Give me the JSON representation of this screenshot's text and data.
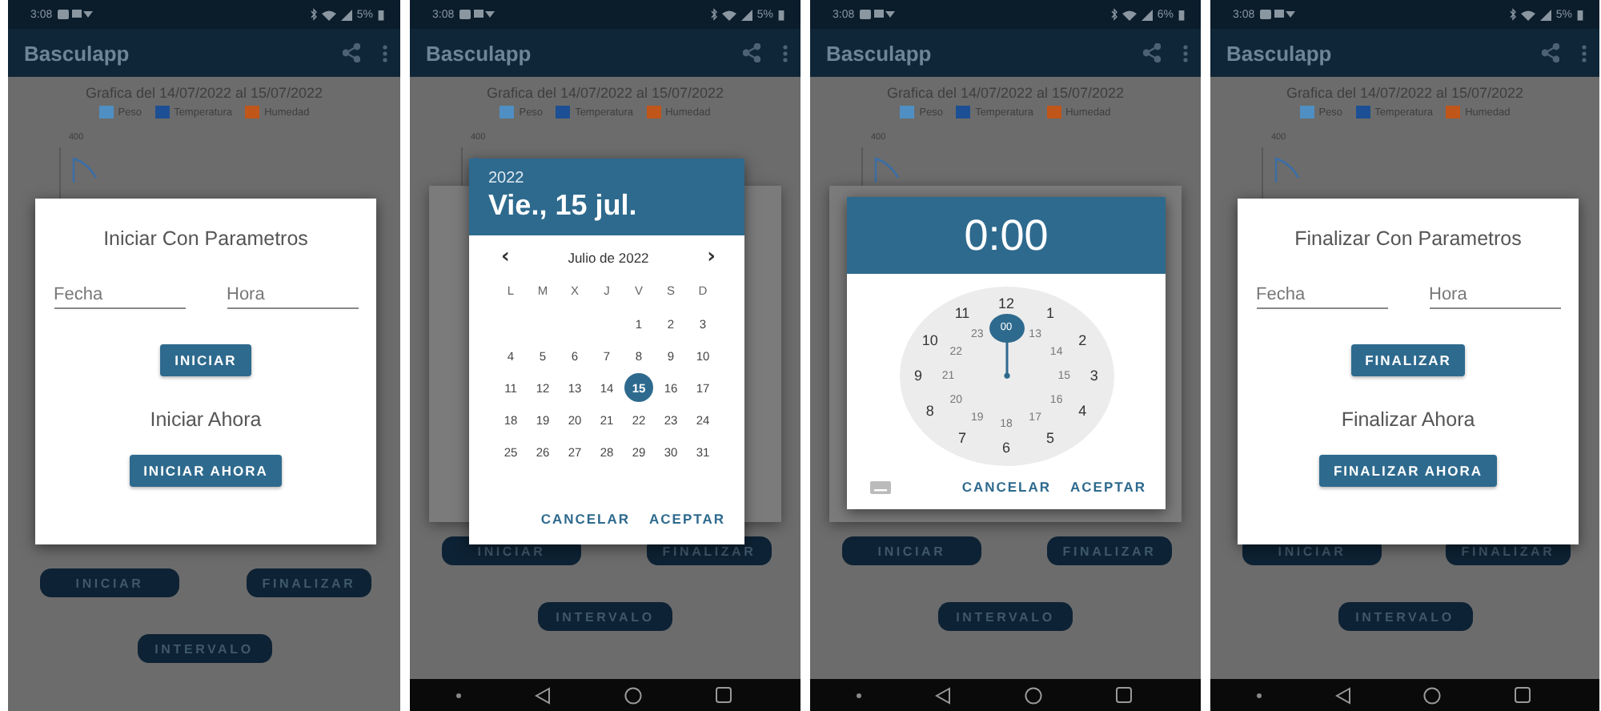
{
  "phones": [
    {
      "status_bar": {
        "time": "3:08",
        "battery": "5%"
      },
      "app_bar": {
        "title": "Basculapp"
      },
      "chart": {
        "title": "Grafica del 14/07/2022 al 15/07/2022",
        "legend": [
          {
            "label": "Peso",
            "color": "#4f8fc4"
          },
          {
            "label": "Temperatura",
            "color": "#1d4f94"
          },
          {
            "label": "Humedad",
            "color": "#c0561a"
          }
        ],
        "y_tick": "400"
      },
      "buttons": [
        "INICIAR",
        "FINALIZAR",
        "INTERVALO"
      ],
      "nav_bar": false,
      "dialog_behind": false,
      "dialog": {
        "kind": "params",
        "title": "Iniciar Con Parametros",
        "fields": [
          {
            "placeholder": "Fecha"
          },
          {
            "placeholder": "Hora"
          }
        ],
        "action": "INICIAR",
        "now_label": "Iniciar Ahora",
        "now_action": "INICIAR AHORA"
      }
    },
    {
      "status_bar": {
        "time": "3:08",
        "battery": "5%"
      },
      "app_bar": {
        "title": "Basculapp"
      },
      "chart": {
        "title": "Grafica del 14/07/2022 al 15/07/2022",
        "legend": [
          {
            "label": "Peso",
            "color": "#4f8fc4"
          },
          {
            "label": "Temperatura",
            "color": "#1d4f94"
          },
          {
            "label": "Humedad",
            "color": "#c0561a"
          }
        ],
        "y_tick": "400"
      },
      "buttons": [
        "INICIAR",
        "FINALIZAR",
        "INTERVALO"
      ],
      "nav_bar": true,
      "dialog_behind": true,
      "dialog": {
        "kind": "date",
        "year": "2022",
        "date": "Vie., 15 jul.",
        "month": "Julio de 2022",
        "prev": "‹",
        "next": "›",
        "weekdays": [
          "L",
          "M",
          "X",
          "J",
          "V",
          "S",
          "D"
        ],
        "weeks": [
          [
            {
              "label": "1",
              "selected": false
            },
            {
              "label": "2",
              "selected": false
            },
            {
              "label": "3",
              "selected": false
            }
          ],
          [
            {
              "label": "4",
              "selected": false
            },
            {
              "label": "5",
              "selected": false
            },
            {
              "label": "6",
              "selected": false
            },
            {
              "label": "7",
              "selected": false
            },
            {
              "label": "8",
              "selected": false
            },
            {
              "label": "9",
              "selected": false
            },
            {
              "label": "10",
              "selected": false
            }
          ],
          [
            {
              "label": "11",
              "selected": false
            },
            {
              "label": "12",
              "selected": false
            },
            {
              "label": "13",
              "selected": false
            },
            {
              "label": "14",
              "selected": false
            },
            {
              "label": "15",
              "selected": true
            },
            {
              "label": "16",
              "selected": false
            },
            {
              "label": "17",
              "selected": false
            }
          ],
          [
            {
              "label": "18",
              "selected": false
            },
            {
              "label": "19",
              "selected": false
            },
            {
              "label": "20",
              "selected": false
            },
            {
              "label": "21",
              "selected": false
            },
            {
              "label": "22",
              "selected": false
            },
            {
              "label": "23",
              "selected": false
            },
            {
              "label": "24",
              "selected": false
            }
          ],
          [
            {
              "label": "25",
              "selected": false
            },
            {
              "label": "26",
              "selected": false
            },
            {
              "label": "27",
              "selected": false
            },
            {
              "label": "28",
              "selected": false
            },
            {
              "label": "29",
              "selected": false
            },
            {
              "label": "30",
              "selected": false
            },
            {
              "label": "31",
              "selected": false
            }
          ]
        ],
        "actions": [
          "CANCELAR",
          "ACEPTAR"
        ]
      }
    },
    {
      "status_bar": {
        "time": "3:08",
        "battery": "6%"
      },
      "app_bar": {
        "title": "Basculapp"
      },
      "chart": {
        "title": "Grafica del 14/07/2022 al 15/07/2022",
        "legend": [
          {
            "label": "Peso",
            "color": "#4f8fc4"
          },
          {
            "label": "Temperatura",
            "color": "#1d4f94"
          },
          {
            "label": "Humedad",
            "color": "#c0561a"
          }
        ],
        "y_tick": "400"
      },
      "buttons": [
        "INICIAR",
        "FINALIZAR",
        "INTERVALO"
      ],
      "nav_bar": true,
      "dialog_behind": true,
      "dialog": {
        "kind": "time",
        "time": "0:00",
        "outer": [
          "12",
          "1",
          "2",
          "3",
          "4",
          "5",
          "6",
          "7",
          "8",
          "9",
          "10",
          "11"
        ],
        "inner": [
          {
            "label": "00",
            "selected": true
          },
          {
            "label": "13",
            "selected": false
          },
          {
            "label": "14",
            "selected": false
          },
          {
            "label": "15",
            "selected": false
          },
          {
            "label": "16",
            "selected": false
          },
          {
            "label": "17",
            "selected": false
          },
          {
            "label": "18",
            "selected": false
          },
          {
            "label": "19",
            "selected": false
          },
          {
            "label": "20",
            "selected": false
          },
          {
            "label": "21",
            "selected": false
          },
          {
            "label": "22",
            "selected": false
          },
          {
            "label": "23",
            "selected": false
          }
        ],
        "actions": [
          "CANCELAR",
          "ACEPTAR"
        ]
      }
    },
    {
      "status_bar": {
        "time": "3:08",
        "battery": "5%"
      },
      "app_bar": {
        "title": "Basculapp"
      },
      "chart": {
        "title": "Grafica del 14/07/2022 al 15/07/2022",
        "legend": [
          {
            "label": "Peso",
            "color": "#4f8fc4"
          },
          {
            "label": "Temperatura",
            "color": "#1d4f94"
          },
          {
            "label": "Humedad",
            "color": "#c0561a"
          }
        ],
        "y_tick": "400"
      },
      "buttons": [
        "INICIAR",
        "FINALIZAR",
        "INTERVALO"
      ],
      "nav_bar": true,
      "dialog_behind": false,
      "dialog": {
        "kind": "params",
        "title": "Finalizar Con Parametros",
        "fields": [
          {
            "placeholder": "Fecha"
          },
          {
            "placeholder": "Hora"
          }
        ],
        "action": "FINALIZAR",
        "now_label": "Finalizar Ahora",
        "now_action": "FINALIZAR AHORA"
      }
    }
  ]
}
